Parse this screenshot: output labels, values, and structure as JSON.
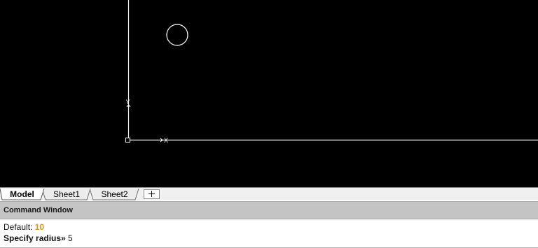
{
  "drawing": {
    "background_color": "#000000",
    "stroke_color": "#ffffff",
    "ucs": {
      "x_label": "X",
      "y_label": "Y"
    }
  },
  "layout_tabs": {
    "tabs": [
      {
        "label": "Model",
        "active": true
      },
      {
        "label": "Sheet1",
        "active": false
      },
      {
        "label": "Sheet2",
        "active": false
      }
    ],
    "add_button_icon": "plus-icon"
  },
  "command_window": {
    "title": "Command Window",
    "history_label": "Default: ",
    "history_value": "10",
    "history_value_color": "#e8950e",
    "prompt_label": "Specify radius»",
    "prompt_value": " 5"
  }
}
